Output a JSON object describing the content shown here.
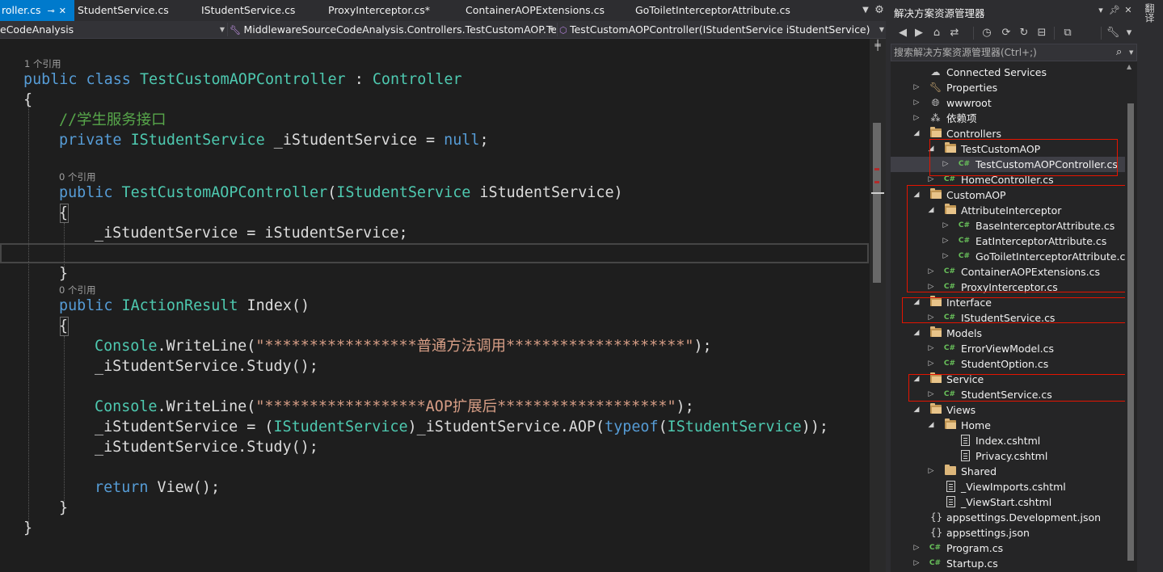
{
  "editor_tabs": [
    {
      "label": "roller.cs",
      "active": true
    },
    {
      "label": "StudentService.cs"
    },
    {
      "label": "IStudentService.cs"
    },
    {
      "label": "ProxyInterceptor.cs*"
    },
    {
      "label": "ContainerAOPExtensions.cs"
    },
    {
      "label": "GoToiletInterceptorAttribute.cs"
    }
  ],
  "navbar": {
    "project": "eCodeAnalysis",
    "class": "MiddlewareSourceCodeAnalysis.Controllers.TestCustomAOP.Tes",
    "member": "TestCustomAOPController(IStudentService iStudentService)"
  },
  "code": {
    "lens_class": "1 个引用",
    "lens_ctor": "0 个引用",
    "lens_index": "0 个引用",
    "line_class": {
      "kw1": "public",
      "kw2": "class",
      "name": "TestCustomAOPController",
      "colon": " : ",
      "base": "Controller"
    },
    "line_open1": "{",
    "line_comment": "//学生服务接口",
    "line_field": {
      "kw": "private",
      "type": "IStudentService",
      "rest": " _iStudentService = ",
      "null": "null",
      "end": ";"
    },
    "line_ctor": {
      "kw": "public",
      "name": "TestCustomAOPController",
      "args_open": "(",
      "ptype": "IStudentService",
      "args_rest": " iStudentService)"
    },
    "line_open2": "{",
    "line_assign": "_iStudentService = iStudentService;",
    "line_close2": "}",
    "line_index": {
      "kw": "public",
      "type": "IActionResult",
      "rest": " Index()"
    },
    "line_open3": "{",
    "line_cw1": {
      "cls": "Console",
      "rest": ".WriteLine(",
      "str": "\"*****************普通方法调用********************\"",
      "end": ");"
    },
    "line_study1": "_iStudentService.Study();",
    "line_cw2": {
      "cls": "Console",
      "rest": ".WriteLine(",
      "str": "\"******************AOP扩展后*******************\"",
      "end": ");"
    },
    "line_aop": {
      "pre": "_iStudentService = (",
      "t1": "IStudentService",
      "mid": ")_iStudentService.AOP(",
      "kw": "typeof",
      "p": "(",
      "t2": "IStudentService",
      "end": "));"
    },
    "line_study2": "_iStudentService.Study();",
    "line_return": {
      "kw": "return",
      "rest": " View();"
    },
    "line_close3": "}",
    "line_close1": "}"
  },
  "solution_explorer": {
    "title": "解决方案资源管理器",
    "search_placeholder": "搜索解决方案资源管理器(Ctrl+;)",
    "items": [
      {
        "label": "Connected Services",
        "icon": "connected-services-icon"
      },
      {
        "label": "Properties",
        "icon": "properties-icon"
      },
      {
        "label": "wwwroot",
        "icon": "globe-icon"
      },
      {
        "label": "依赖项",
        "icon": "dependencies-icon"
      },
      {
        "label": "Controllers",
        "icon": "folder-open-icon"
      },
      {
        "label": "TestCustomAOP",
        "icon": "folder-open-icon"
      },
      {
        "label": "TestCustomAOPController.cs",
        "icon": "csharp-file-icon",
        "selected": true
      },
      {
        "label": "HomeController.cs",
        "icon": "csharp-file-icon"
      },
      {
        "label": "CustomAOP",
        "icon": "folder-open-icon"
      },
      {
        "label": "AttributeInterceptor",
        "icon": "folder-open-icon"
      },
      {
        "label": "BaseInterceptorAttribute.cs",
        "icon": "csharp-file-icon"
      },
      {
        "label": "EatInterceptorAttribute.cs",
        "icon": "csharp-file-icon"
      },
      {
        "label": "GoToiletInterceptorAttribute.cs",
        "icon": "csharp-file-icon"
      },
      {
        "label": "ContainerAOPExtensions.cs",
        "icon": "csharp-file-icon"
      },
      {
        "label": "ProxyInterceptor.cs",
        "icon": "csharp-file-icon"
      },
      {
        "label": "Interface",
        "icon": "folder-open-icon"
      },
      {
        "label": "IStudentService.cs",
        "icon": "csharp-file-icon"
      },
      {
        "label": "Models",
        "icon": "folder-open-icon"
      },
      {
        "label": "ErrorViewModel.cs",
        "icon": "csharp-file-icon"
      },
      {
        "label": "StudentOption.cs",
        "icon": "csharp-file-icon"
      },
      {
        "label": "Service",
        "icon": "folder-open-icon"
      },
      {
        "label": "StudentService.cs",
        "icon": "csharp-file-icon"
      },
      {
        "label": "Views",
        "icon": "folder-open-icon"
      },
      {
        "label": "Home",
        "icon": "folder-open-icon"
      },
      {
        "label": "Index.cshtml",
        "icon": "razor-file-icon"
      },
      {
        "label": "Privacy.cshtml",
        "icon": "razor-file-icon"
      },
      {
        "label": "Shared",
        "icon": "folder-icon"
      },
      {
        "label": "_ViewImports.cshtml",
        "icon": "razor-file-icon"
      },
      {
        "label": "_ViewStart.cshtml",
        "icon": "razor-file-icon"
      },
      {
        "label": "appsettings.Development.json",
        "icon": "json-file-icon"
      },
      {
        "label": "appsettings.json",
        "icon": "json-file-icon"
      },
      {
        "label": "Program.cs",
        "icon": "csharp-file-icon"
      },
      {
        "label": "Startup.cs",
        "icon": "csharp-file-icon"
      }
    ]
  },
  "side_tab": "翻译",
  "colors": {
    "accent": "#007acc",
    "highlight_box": "#e51400",
    "keyword": "#569cd6",
    "type": "#4ec9b0",
    "comment": "#57a64a",
    "string": "#d69d85"
  }
}
